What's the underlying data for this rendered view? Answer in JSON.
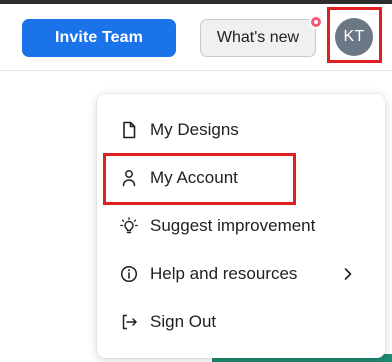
{
  "header": {
    "invite_label": "Invite Team",
    "whats_new_label": "What's new",
    "avatar_initials": "KT",
    "notification_color": "#f05b7a",
    "accent_color": "#1a73e8",
    "avatar_color": "#6b7785"
  },
  "menu": {
    "items": [
      {
        "label": "My Designs",
        "icon": "document-icon"
      },
      {
        "label": "My Account",
        "icon": "user-icon"
      },
      {
        "label": "Suggest improvement",
        "icon": "lightbulb-icon"
      },
      {
        "label": "Help and resources",
        "icon": "info-icon",
        "has_submenu": true
      },
      {
        "label": "Sign Out",
        "icon": "sign-out-icon"
      }
    ]
  }
}
